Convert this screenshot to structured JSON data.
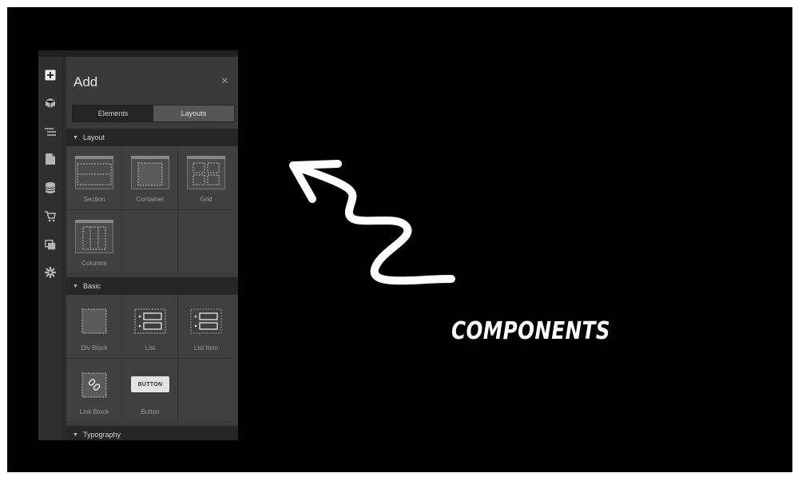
{
  "panel": {
    "title": "Add",
    "close_glyph": "×",
    "tabs": [
      {
        "label": "Elements",
        "active": true
      },
      {
        "label": "Layouts",
        "active": false
      }
    ]
  },
  "rail_icons": [
    "add-icon",
    "cube-icon",
    "navigator-icon",
    "pages-icon",
    "cms-icon",
    "ecommerce-icon",
    "assets-icon",
    "settings-icon"
  ],
  "sections": [
    {
      "name": "Layout",
      "items": [
        "Section",
        "Container",
        "Grid",
        "Columns"
      ]
    },
    {
      "name": "Basic",
      "items": [
        "Div Block",
        "List",
        "List Item",
        "Link Block",
        "Button"
      ]
    },
    {
      "name": "Typography",
      "items": []
    }
  ],
  "button_thumb_text": "BUTTON",
  "annotation": {
    "text": "COMPONENTS"
  },
  "colors": {
    "background": "#000000",
    "panel": "#3a3a3a",
    "section_header": "#262626",
    "annotation": "#ffffff"
  }
}
